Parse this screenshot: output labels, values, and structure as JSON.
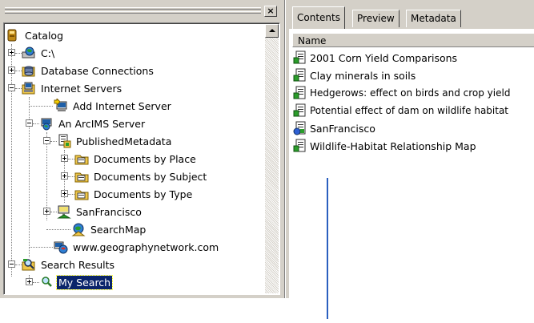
{
  "tree": {
    "close_glyph": "×",
    "rows": [
      {
        "label": "Catalog",
        "icon": "catalog-icon"
      },
      {
        "label": "C:\\",
        "icon": "drive-icon"
      },
      {
        "label": "Database Connections",
        "icon": "database-connections-icon"
      },
      {
        "label": "Internet Servers",
        "icon": "internet-servers-icon"
      },
      {
        "label": "Add Internet Server",
        "icon": "add-server-icon"
      },
      {
        "label": "An ArcIMS Server",
        "icon": "arcims-server-icon"
      },
      {
        "label": "PublishedMetadata",
        "icon": "metadata-service-icon"
      },
      {
        "label": "Documents by Place",
        "icon": "folder-icon"
      },
      {
        "label": "Documents by Subject",
        "icon": "folder-icon"
      },
      {
        "label": "Documents by Type",
        "icon": "folder-icon"
      },
      {
        "label": "SanFrancisco",
        "icon": "map-service-icon"
      },
      {
        "label": "SearchMap",
        "icon": "search-map-icon"
      },
      {
        "label": "www.geographynetwork.com",
        "icon": "geography-network-icon"
      },
      {
        "label": "Search Results",
        "icon": "search-results-icon"
      },
      {
        "label": "My Search",
        "icon": "search-icon",
        "selected": true
      }
    ]
  },
  "tabs": [
    {
      "label": "Contents",
      "active": true
    },
    {
      "label": "Preview",
      "active": false
    },
    {
      "label": "Metadata",
      "active": false
    }
  ],
  "contents": {
    "column_name": "Name",
    "items": [
      {
        "label": "2001 Corn Yield Comparisons",
        "icon": "metadata-document-icon"
      },
      {
        "label": "Clay minerals in soils",
        "icon": "metadata-document-icon"
      },
      {
        "label": "Hedgerows: effect on birds and crop yield",
        "icon": "metadata-document-icon"
      },
      {
        "label": "Potential effect of dam on wildlife habitat",
        "icon": "metadata-document-icon"
      },
      {
        "label": "SanFrancisco",
        "icon": "metadata-service-document-icon"
      },
      {
        "label": "Wildlife-Habitat Relationship Map",
        "icon": "metadata-document-icon"
      }
    ]
  }
}
